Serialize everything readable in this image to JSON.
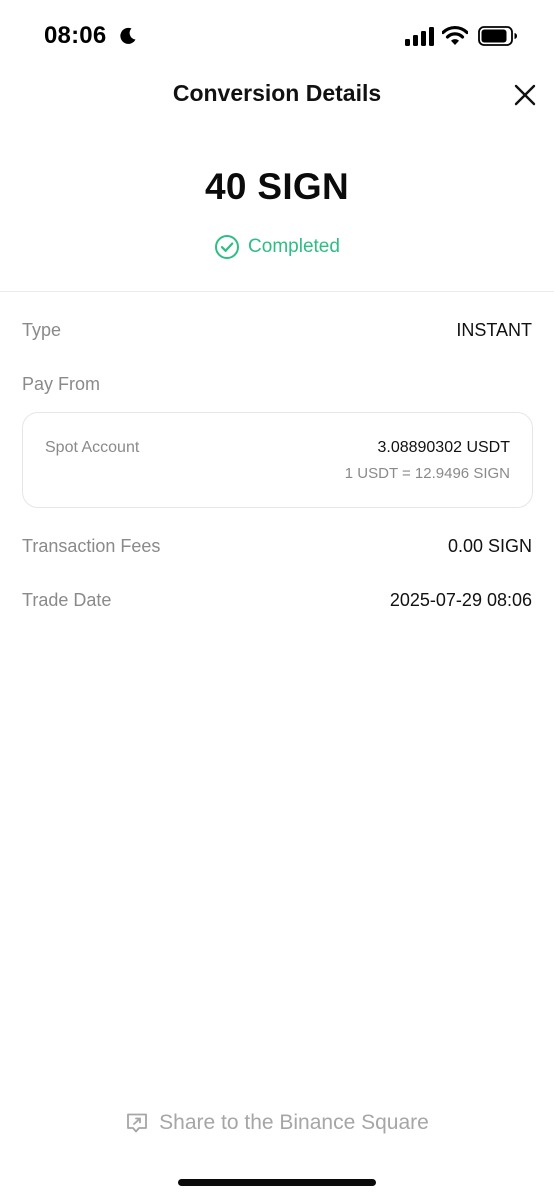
{
  "status_bar": {
    "time": "08:06",
    "icons": [
      "moon-icon",
      "signal-icon",
      "wifi-icon",
      "battery-icon"
    ]
  },
  "header": {
    "title": "Conversion Details",
    "close_icon": "close-icon"
  },
  "summary": {
    "amount": "40 SIGN",
    "status": "Completed",
    "status_color": "#2ebd85"
  },
  "details": {
    "type_label": "Type",
    "type_value": "INSTANT",
    "pay_from_label": "Pay From",
    "pay_from_card": {
      "account": "Spot Account",
      "amount": "3.08890302 USDT",
      "rate": "1 USDT = 12.9496 SIGN"
    },
    "fees_label": "Transaction Fees",
    "fees_value": "0.00 SIGN",
    "date_label": "Trade Date",
    "date_value": "2025-07-29 08:06"
  },
  "footer": {
    "share_label": "Share to the Binance Square",
    "share_icon": "share-icon"
  }
}
